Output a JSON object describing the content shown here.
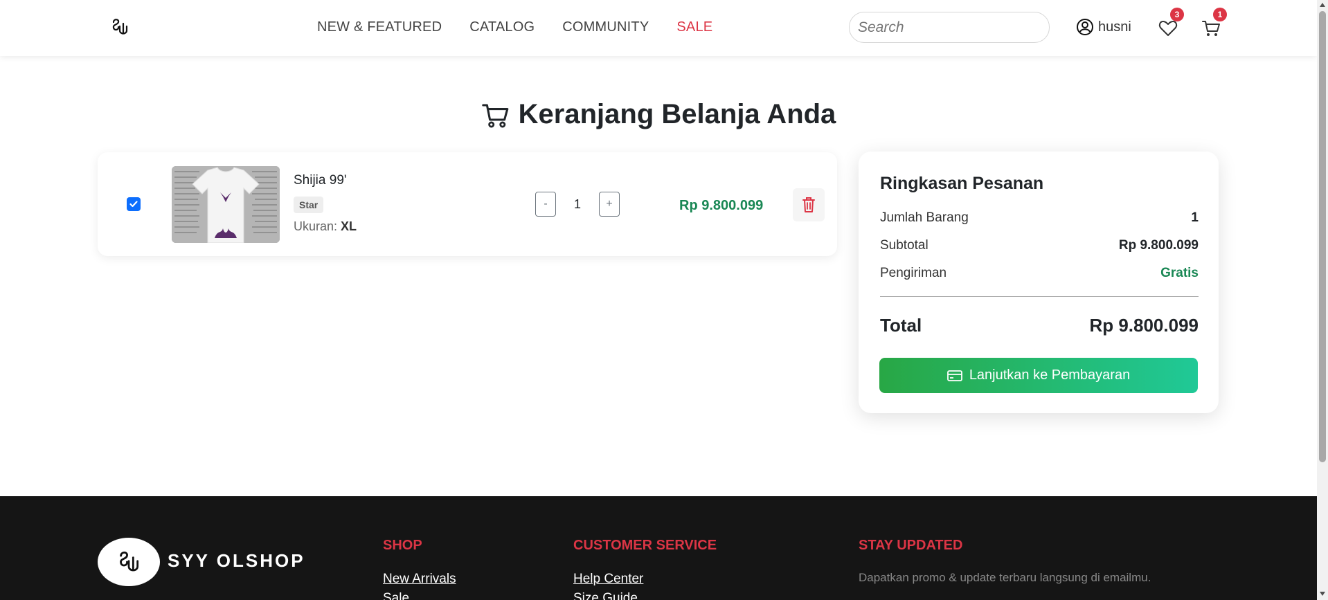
{
  "navbar": {
    "logo_icon": "syy-logo-icon",
    "links": [
      {
        "label": "NEW & FEATURED"
      },
      {
        "label": "CATALOG"
      },
      {
        "label": "COMMUNITY"
      },
      {
        "label": "SALE",
        "color": "#dc3545"
      }
    ],
    "search_placeholder": "Search",
    "user_icon": "user-circle-icon",
    "username": "husni",
    "wishlist_icon": "heart-icon",
    "wishlist_count": "3",
    "cart_icon": "cart-icon",
    "cart_count": "1"
  },
  "page": {
    "title_icon": "cart-icon",
    "title": "Keranjang Belanja Anda"
  },
  "cart": {
    "items": [
      {
        "selected": true,
        "name": "Shijia 99'",
        "tag": "Star",
        "size_label": "Ukuran:",
        "size_value": "XL",
        "quantity": "1",
        "decrement_label": "-",
        "increment_label": "+",
        "price": "Rp 9.800.099",
        "delete_icon": "trash-icon"
      }
    ]
  },
  "summary": {
    "title": "Ringkasan Pesanan",
    "rows": [
      {
        "label": "Jumlah Barang",
        "value": "1"
      },
      {
        "label": "Subtotal",
        "value": "Rp 9.800.099"
      },
      {
        "label": "Pengiriman",
        "value": "Gratis"
      }
    ],
    "total_label": "Total",
    "total_value": "Rp 9.800.099",
    "checkout_icon": "credit-card-icon",
    "checkout_label": "Lanjutkan ke Pembayaran"
  },
  "footer": {
    "brand": "SYY OLSHOP",
    "shop": {
      "heading": "SHOP",
      "links": [
        "New Arrivals",
        "Sale"
      ]
    },
    "customer_service": {
      "heading": "CUSTOMER SERVICE",
      "links": [
        "Help Center",
        "Size Guide"
      ]
    },
    "stay_updated": {
      "heading": "STAY UPDATED",
      "text": "Dapatkan promo & update terbaru langsung di emailmu."
    }
  },
  "colors": {
    "accent_red": "#dc3545",
    "price_green": "#198754",
    "checkbox_blue": "#0d6efd",
    "checkout_gradient_start": "#28a745",
    "checkout_gradient_end": "#20c997",
    "footer_bg": "#151515"
  }
}
